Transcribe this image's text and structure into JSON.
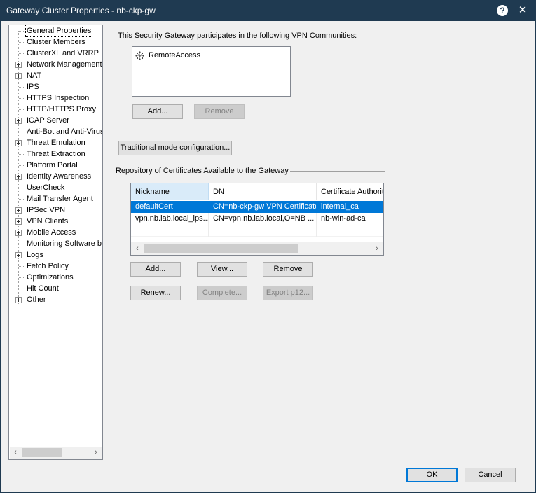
{
  "window": {
    "title": "Gateway Cluster Properties - nb-ckp-gw",
    "help_glyph": "?",
    "close_glyph": "✕"
  },
  "nav": {
    "items": [
      {
        "label": "General Properties",
        "expandable": false,
        "selected": true
      },
      {
        "label": "Cluster Members",
        "expandable": false
      },
      {
        "label": "ClusterXL and VRRP",
        "expandable": false
      },
      {
        "label": "Network Management",
        "expandable": true
      },
      {
        "label": "NAT",
        "expandable": true
      },
      {
        "label": "IPS",
        "expandable": false
      },
      {
        "label": "HTTPS Inspection",
        "expandable": false
      },
      {
        "label": "HTTP/HTTPS Proxy",
        "expandable": false
      },
      {
        "label": "ICAP Server",
        "expandable": true
      },
      {
        "label": "Anti-Bot and Anti-Virus",
        "expandable": false
      },
      {
        "label": "Threat Emulation",
        "expandable": true
      },
      {
        "label": "Threat Extraction",
        "expandable": false
      },
      {
        "label": "Platform Portal",
        "expandable": false
      },
      {
        "label": "Identity Awareness",
        "expandable": true
      },
      {
        "label": "UserCheck",
        "expandable": false
      },
      {
        "label": "Mail Transfer Agent",
        "expandable": false
      },
      {
        "label": "IPSec VPN",
        "expandable": true
      },
      {
        "label": "VPN Clients",
        "expandable": true
      },
      {
        "label": "Mobile Access",
        "expandable": true
      },
      {
        "label": "Monitoring Software bla",
        "expandable": false
      },
      {
        "label": "Logs",
        "expandable": true
      },
      {
        "label": "Fetch Policy",
        "expandable": false
      },
      {
        "label": "Optimizations",
        "expandable": false
      },
      {
        "label": "Hit Count",
        "expandable": false
      },
      {
        "label": "Other",
        "expandable": true
      }
    ]
  },
  "vpn": {
    "heading": "This Security Gateway participates in the following VPN Communities:",
    "communities": [
      "RemoteAccess"
    ],
    "add_label": "Add...",
    "remove_label": "Remove"
  },
  "traditional_mode_label": "Traditional mode configuration...",
  "certificates": {
    "group_label": "Repository of Certificates Available to the Gateway",
    "columns": [
      "Nickname",
      "DN",
      "Certificate Authority"
    ],
    "rows": [
      {
        "nickname": "defaultCert",
        "dn": "CN=nb-ckp-gw VPN Certificate",
        "ca": "internal_ca",
        "selected": true
      },
      {
        "nickname": "vpn.nb.lab.local_ips...",
        "dn": "CN=vpn.nb.lab.local,O=NB ...",
        "ca": "nb-win-ad-ca",
        "selected": false
      }
    ],
    "buttons": {
      "add": "Add...",
      "view": "View...",
      "remove": "Remove",
      "renew": "Renew...",
      "complete": "Complete...",
      "export": "Export p12..."
    }
  },
  "footer": {
    "ok_label": "OK",
    "cancel_label": "Cancel"
  },
  "colors": {
    "titlebar": "#1f3a51",
    "selection": "#0078d7",
    "sorted_header": "#d9ebf9"
  }
}
